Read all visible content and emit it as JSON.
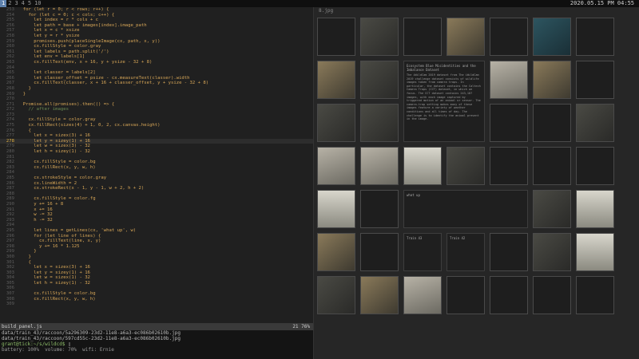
{
  "topbar": {
    "workspaces": [
      "1",
      "2",
      "3",
      "4",
      "5",
      "10"
    ],
    "active_workspace": "1",
    "clock": "2020.05.15 PM 04:55"
  },
  "editor": {
    "current_line_index": 25,
    "lines": [
      {
        "n": "253",
        "t": "  for (let r = 0; r < rows; r++) {"
      },
      {
        "n": "254",
        "t": "    for (let c = 0; c < cols; c++) {"
      },
      {
        "n": "255",
        "t": "      let index = r * cols + c"
      },
      {
        "n": "256",
        "t": "      let path = base + images[index].image_path"
      },
      {
        "n": "257",
        "t": "      let x = c * xsize"
      },
      {
        "n": "258",
        "t": "      let y = r * ysize"
      },
      {
        "n": "259",
        "t": "      promises.push(placeSingleImage(cx, path, x, y))"
      },
      {
        "n": "260",
        "t": "      cx.fillStyle = color.gray"
      },
      {
        "n": "261",
        "t": "      let labels = path.split('/')"
      },
      {
        "n": "262",
        "t": "      let env = labels[1]"
      },
      {
        "n": "263",
        "t": "      cx.fillText(env, x + 16, y + ysize - 32 + 8)"
      },
      {
        "n": "264",
        "t": ""
      },
      {
        "n": "265",
        "t": "      let classer = labels[2]"
      },
      {
        "n": "266",
        "t": "      let classer_offset = psize - cx.measureText(classer).width"
      },
      {
        "n": "267",
        "t": "      cx.fillText(classer, x + 16 + classer_offset, y + ysize - 32 + 8)"
      },
      {
        "n": "268",
        "t": "    }"
      },
      {
        "n": "269",
        "t": "  }"
      },
      {
        "n": "270",
        "t": ""
      },
      {
        "n": "271",
        "t": "  Promise.all(promises).then(() => {"
      },
      {
        "n": "272",
        "t": "    // after images",
        "c": true
      },
      {
        "n": "273",
        "t": ""
      },
      {
        "n": "274",
        "t": "    cx.fillStyle = color.gray"
      },
      {
        "n": "275",
        "t": "    cx.fillRect(sizes(4) + 1, 0, 2, cx.canvas.height)"
      },
      {
        "n": "276",
        "t": "    {"
      },
      {
        "n": "277",
        "t": "      let x = sizex(3) + 16"
      },
      {
        "n": "278",
        "t": "      let y = sizey(1) + 16"
      },
      {
        "n": "279",
        "t": "      let w = sizex(3) - 32"
      },
      {
        "n": "280",
        "t": "      let h = sizey(1) - 32"
      },
      {
        "n": "281",
        "t": ""
      },
      {
        "n": "282",
        "t": "      cx.fillStyle = color.bg"
      },
      {
        "n": "283",
        "t": "      cx.fillRect(x, y, w, h)"
      },
      {
        "n": "284",
        "t": ""
      },
      {
        "n": "285",
        "t": "      cx.strokeStyle = color.gray"
      },
      {
        "n": "286",
        "t": "      cx.lineWidth = 2"
      },
      {
        "n": "287",
        "t": "      cx.strokeRect(x - 1, y - 1, w + 2, h + 2)"
      },
      {
        "n": "288",
        "t": ""
      },
      {
        "n": "289",
        "t": "      cx.fillStyle = color.fg"
      },
      {
        "n": "290",
        "t": "      y += 16 + 8"
      },
      {
        "n": "291",
        "t": "      x += 16"
      },
      {
        "n": "292",
        "t": "      w -= 32"
      },
      {
        "n": "293",
        "t": "      h -= 32"
      },
      {
        "n": "294",
        "t": ""
      },
      {
        "n": "295",
        "t": "      let lines = getLines(cx, 'what up', w)"
      },
      {
        "n": "296",
        "t": "      for (let line of lines) {"
      },
      {
        "n": "297",
        "t": "        cx.fillText(line, x, y)"
      },
      {
        "n": "298",
        "t": "        y += 16 * 1.125"
      },
      {
        "n": "299",
        "t": "      }"
      },
      {
        "n": "300",
        "t": "    }"
      },
      {
        "n": "301",
        "t": "    {"
      },
      {
        "n": "302",
        "t": "      let x = sizex(3) + 16"
      },
      {
        "n": "303",
        "t": "      let y = sizey(1) + 16"
      },
      {
        "n": "304",
        "t": "      let w = sizex(1) - 32"
      },
      {
        "n": "305",
        "t": "      let h = sizey(1) - 32"
      },
      {
        "n": "306",
        "t": ""
      },
      {
        "n": "307",
        "t": "      cx.fillStyle = color.bg"
      },
      {
        "n": "308",
        "t": "      cx.fillRect(x, y, w, h)"
      },
      {
        "n": "309",
        "t": ""
      }
    ],
    "status": {
      "filename": "build_panel.js",
      "position": "21 76%"
    }
  },
  "terminal": {
    "lines": [
      "data/train_43/raccoon/5a296309-23d2-11e8-a6a3-ec086b02610b.jpg",
      "data/train_43/raccoon/597cd55c-23d2-11e8-a6a3-ec086b02610b.jpg"
    ],
    "prompt": "grant@tick:~/s/wildcd$ ",
    "battery": "battery: 100%  volume: 70%  wifi: Ernie"
  },
  "viewer": {
    "header": "8.jpg",
    "panel_main_title": "Ecosystem Blue Misidentities and the Imbalance Dataset",
    "panel_main_text": "The iWildCam 2019 dataset from The iWildCam 2019 challenge dataset consists of wildlife images taken from camera traps. In particular, the dataset contains the Caltech Camera Traps (CCT) dataset, in which we focus. The CCT dataset contains 243,187 images, with each image captured by triggered motion of an animal or sensor. The camera-trap setting makes many of these images feature a variety of weather conditions and all times of day. The challenge is to identify the animal present in the image.",
    "panel_small_1": "what up",
    "panel_small_2": "Train 43",
    "panel_small_3": "Train 42"
  }
}
